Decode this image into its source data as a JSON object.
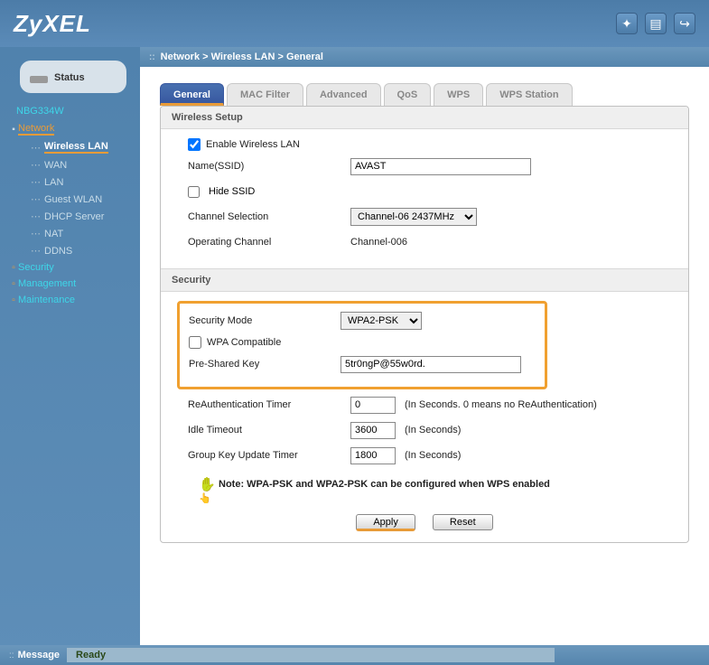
{
  "logo": "ZyXEL",
  "header_icons": {
    "wizard": "wizard-icon",
    "doc": "doc-icon",
    "logout": "logout-icon"
  },
  "breadcrumb": "Network > Wireless LAN > General",
  "sidebar": {
    "status_label": "Status",
    "device": "NBG334W",
    "items": [
      {
        "label": "Network",
        "expanded": true,
        "highlighted": true,
        "children": [
          {
            "label": "Wireless LAN",
            "highlighted": true
          },
          {
            "label": "WAN"
          },
          {
            "label": "LAN"
          },
          {
            "label": "Guest WLAN"
          },
          {
            "label": "DHCP Server"
          },
          {
            "label": "NAT"
          },
          {
            "label": "DDNS"
          }
        ]
      },
      {
        "label": "Security",
        "expanded": false,
        "color": "#3ED6E8"
      },
      {
        "label": "Management",
        "expanded": false,
        "color": "#3ED6E8"
      },
      {
        "label": "Maintenance",
        "expanded": false,
        "color": "#3ED6E8"
      }
    ]
  },
  "tabs": [
    {
      "label": "General",
      "active": true
    },
    {
      "label": "MAC Filter"
    },
    {
      "label": "Advanced"
    },
    {
      "label": "QoS"
    },
    {
      "label": "WPS"
    },
    {
      "label": "WPS Station"
    }
  ],
  "sections": {
    "wireless_setup_title": "Wireless Setup",
    "security_title": "Security"
  },
  "wireless": {
    "enable_label": "Enable Wireless LAN",
    "enable_checked": true,
    "ssid_label": "Name(SSID)",
    "ssid_value": "AVAST",
    "hide_ssid_label": "Hide SSID",
    "hide_ssid_checked": false,
    "channel_sel_label": "Channel Selection",
    "channel_sel_value": "Channel-06 2437MHz",
    "op_channel_label": "Operating Channel",
    "op_channel_value": "Channel-006"
  },
  "security": {
    "mode_label": "Security Mode",
    "mode_value": "WPA2-PSK",
    "wpa_compat_label": "WPA Compatible",
    "wpa_compat_checked": false,
    "psk_label": "Pre-Shared Key",
    "psk_value": "5tr0ngP@55w0rd.",
    "reauth_label": "ReAuthentication Timer",
    "reauth_value": "0",
    "reauth_hint": "(In Seconds. 0 means no ReAuthentication)",
    "idle_label": "Idle Timeout",
    "idle_value": "3600",
    "idle_hint": "(In Seconds)",
    "gkey_label": "Group Key Update Timer",
    "gkey_value": "1800",
    "gkey_hint": "(In Seconds)",
    "note": "Note: WPA-PSK and WPA2-PSK can be configured when WPS enabled"
  },
  "buttons": {
    "apply": "Apply",
    "reset": "Reset"
  },
  "footer": {
    "label": "Message",
    "text": "Ready"
  }
}
